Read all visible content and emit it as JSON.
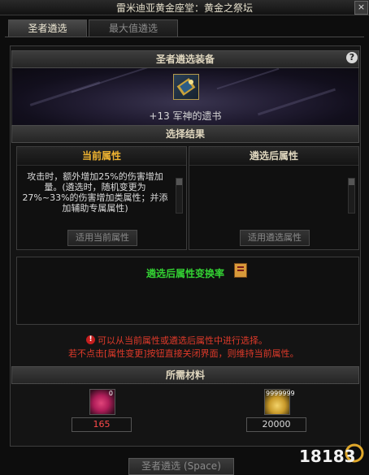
{
  "window": {
    "title": "雷米迪亚黄金座堂：黄金之祭坛",
    "close_label": "×"
  },
  "tabs": [
    {
      "label": "圣者遴选",
      "active": true
    },
    {
      "label": "最大值遴选",
      "active": false
    }
  ],
  "equip": {
    "header": "圣者遴选装备",
    "help_label": "?",
    "item_name": "+13 军神的遗书"
  },
  "result": {
    "header": "选择结果"
  },
  "current": {
    "title": "当前属性",
    "text": "攻击时，额外增加25%的伤害增加量。(遴选时，随机变更为27%~33%的伤害增加类属性；并添加辅助专属属性)",
    "button": "适用当前属性"
  },
  "after": {
    "title": "遴选后属性",
    "text": "",
    "button": "适用遴选属性"
  },
  "rate": {
    "label": "遴选后属性变换率"
  },
  "warning": {
    "line1": "可以从当前属性或遴选后属性中进行选择。",
    "line2": "若不点击[属性变更]按钮直接关闭界面，则维持当前属性。"
  },
  "materials": {
    "header": "所需材料",
    "items": [
      {
        "icon": "pink-gem-icon",
        "corner": "0",
        "amount": "165"
      },
      {
        "icon": "gold-coin-pile-icon",
        "corner": "9999999",
        "amount": "20000"
      }
    ]
  },
  "footer": {
    "button": "圣者遴选 (Space)"
  },
  "watermark": {
    "text": "18183"
  },
  "colors": {
    "current_title": "#f0b431",
    "rate_label": "#33d233",
    "warning": "#e03a2a",
    "insufficient": "#ff4a4a"
  }
}
